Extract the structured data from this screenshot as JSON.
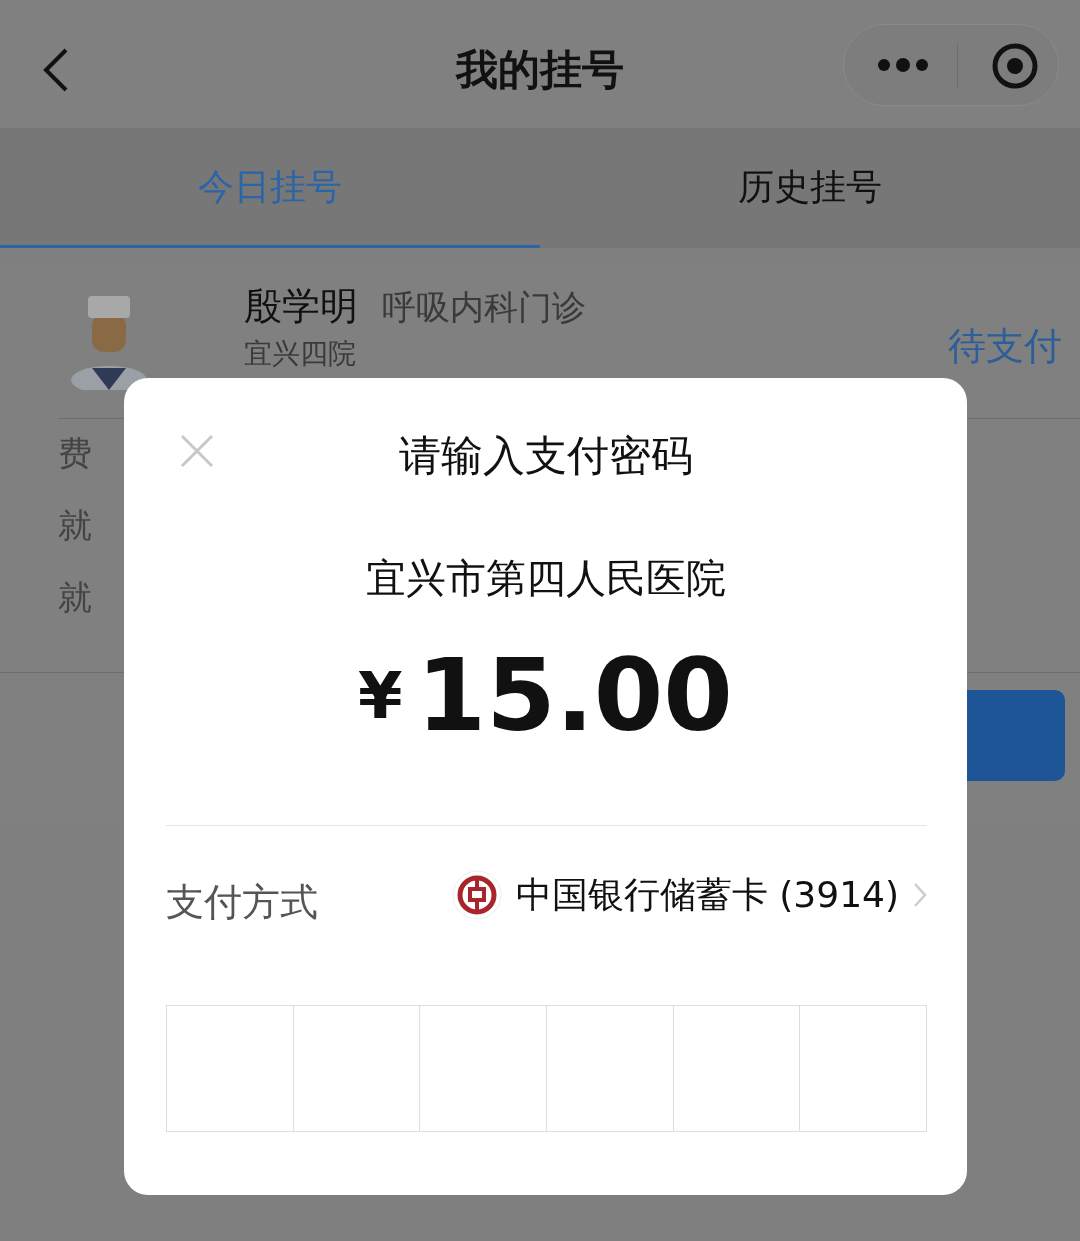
{
  "nav": {
    "title": "我的挂号"
  },
  "tabs": [
    {
      "label": "今日挂号",
      "selected": true
    },
    {
      "label": "历史挂号",
      "selected": false
    }
  ],
  "appointment": {
    "doctor": "殷学明",
    "department": "呼吸内科门诊",
    "hospital": "宜兴四院",
    "status": "待支付",
    "fields": [
      "费",
      "就",
      "就"
    ]
  },
  "payment_dialog": {
    "title": "请输入支付密码",
    "merchant": "宜兴市第四人民医院",
    "currency": "¥",
    "amount": "15.00",
    "method_label": "支付方式",
    "method": "中国银行储蓄卡 (3914)",
    "pin_boxes": [
      {
        "filled": false
      },
      {
        "filled": false
      },
      {
        "filled": false
      },
      {
        "filled": false
      },
      {
        "filled": false
      },
      {
        "filled": false
      }
    ]
  }
}
